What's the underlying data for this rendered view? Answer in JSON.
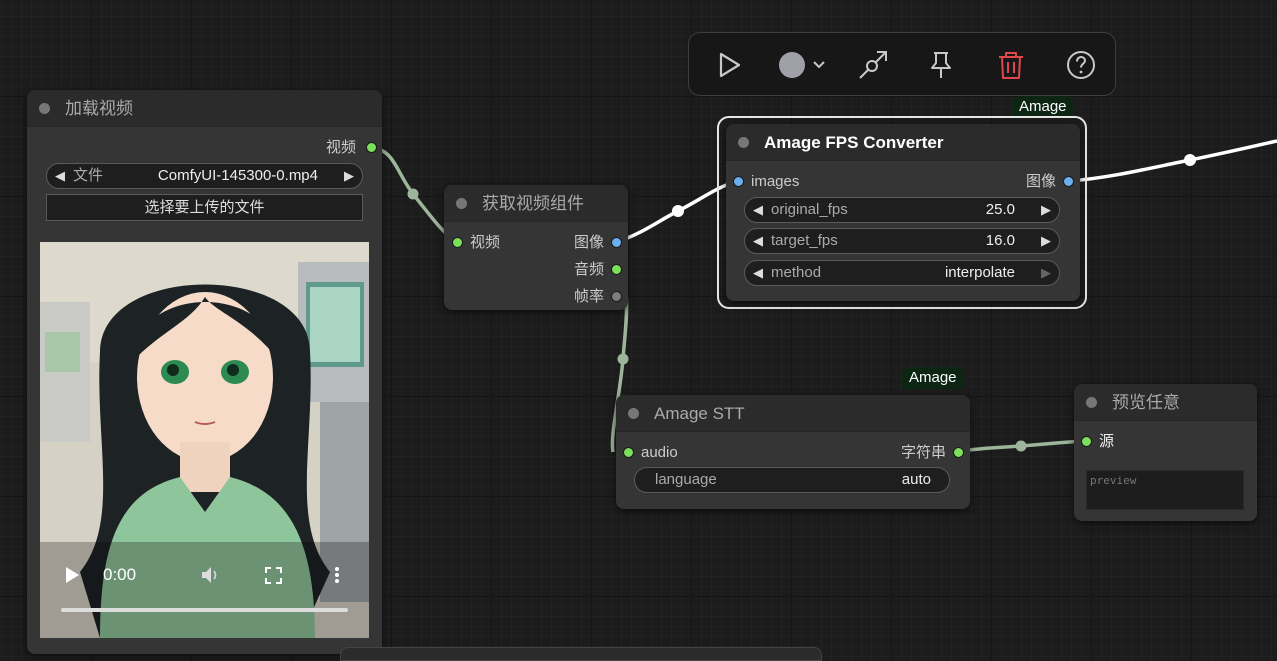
{
  "toolbar": {
    "buttons": [
      "run-icon",
      "color-icon",
      "bypass-icon",
      "pin-icon",
      "delete-icon",
      "help-icon"
    ],
    "delete_color": "#e0474c",
    "icon_color": "#c8c8c8"
  },
  "load_video": {
    "title": "加载视频",
    "output_label": "视频",
    "file_label": "文件",
    "file_value": "ComfyUI-145300-0.mp4",
    "upload_label": "选择要上传的文件",
    "player": {
      "time": "0:00"
    }
  },
  "get_video": {
    "title": "获取视频组件",
    "input_label": "视频",
    "outputs": [
      "图像",
      "音频",
      "帧率"
    ]
  },
  "fps_converter": {
    "badge": "Amage",
    "title": "Amage FPS Converter",
    "input_label": "images",
    "output_label": "图像",
    "widgets": [
      {
        "label": "original_fps",
        "value": "25.0"
      },
      {
        "label": "target_fps",
        "value": "16.0"
      },
      {
        "label": "method",
        "value": "interpolate"
      }
    ]
  },
  "stt": {
    "badge": "Amage",
    "title": "Amage STT",
    "input_label": "audio",
    "output_label": "字符串",
    "widget": {
      "label": "language",
      "value": "auto"
    }
  },
  "preview": {
    "title": "预览任意",
    "input_label": "源",
    "placeholder": "preview"
  },
  "colors": {
    "image_slot": "#6aaff0",
    "video_slot": "#7be05a",
    "wire_video": "#9db59a",
    "wire_image": "#ffffff"
  }
}
